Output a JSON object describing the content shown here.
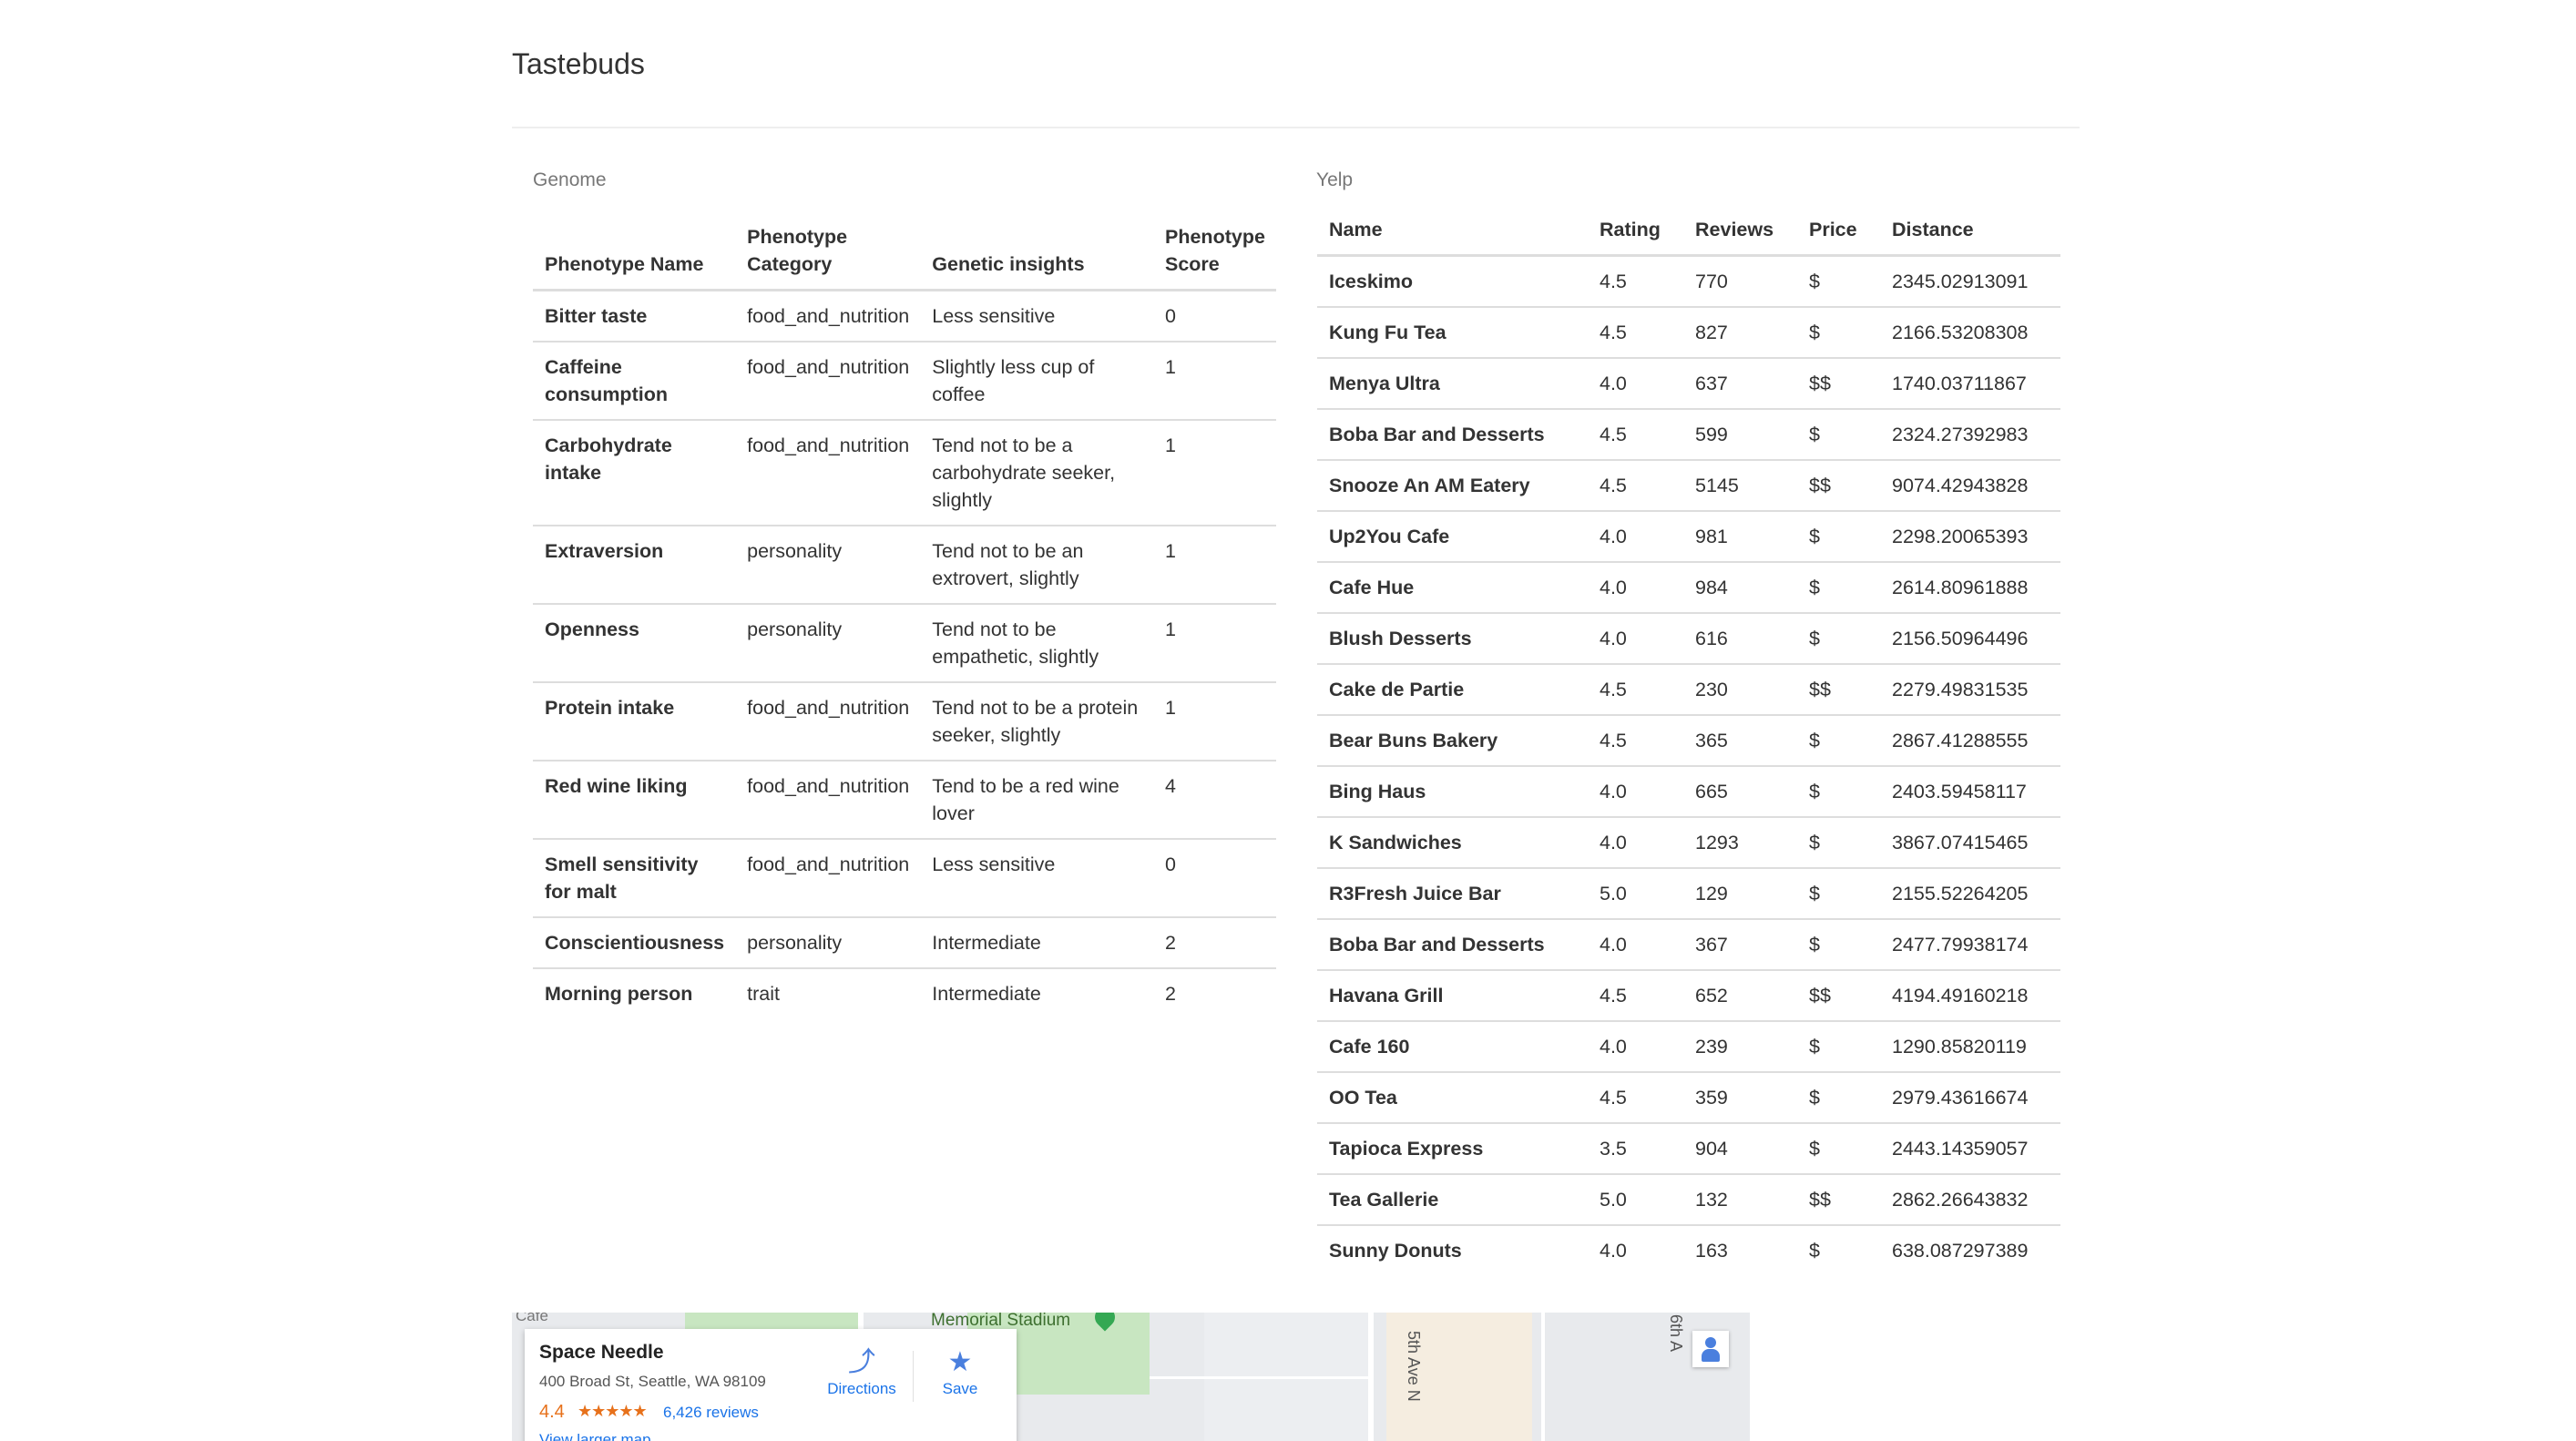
{
  "app": {
    "title": "Tastebuds"
  },
  "genome": {
    "heading": "Genome",
    "columns": [
      "Phenotype Name",
      "Phenotype Category",
      "Genetic insights",
      "Phenotype Score"
    ],
    "rows": [
      [
        "Bitter taste",
        "food_and_nutrition",
        "Less sensitive",
        "0"
      ],
      [
        "Caffeine consumption",
        "food_and_nutrition",
        "Slightly less cup of coffee",
        "1"
      ],
      [
        "Carbohydrate intake",
        "food_and_nutrition",
        "Tend not to be a carbohydrate seeker, slightly",
        "1"
      ],
      [
        "Extraversion",
        "personality",
        "Tend not to be an extrovert, slightly",
        "1"
      ],
      [
        "Openness",
        "personality",
        "Tend not to be empathetic, slightly",
        "1"
      ],
      [
        "Protein intake",
        "food_and_nutrition",
        "Tend not to be a protein seeker, slightly",
        "1"
      ],
      [
        "Red wine liking",
        "food_and_nutrition",
        "Tend to be a red wine lover",
        "4"
      ],
      [
        "Smell sensitivity for malt",
        "food_and_nutrition",
        "Less sensitive",
        "0"
      ],
      [
        "Conscientiousness",
        "personality",
        "Intermediate",
        "2"
      ],
      [
        "Morning person",
        "trait",
        "Intermediate",
        "2"
      ]
    ]
  },
  "yelp": {
    "heading": "Yelp",
    "columns": [
      "Name",
      "Rating",
      "Reviews",
      "Price",
      "Distance"
    ],
    "rows": [
      [
        "Iceskimo",
        "4.5",
        "770",
        "$",
        "2345.02913091"
      ],
      [
        "Kung Fu Tea",
        "4.5",
        "827",
        "$",
        "2166.53208308"
      ],
      [
        "Menya Ultra",
        "4.0",
        "637",
        "$$",
        "1740.03711867"
      ],
      [
        "Boba Bar and Desserts",
        "4.5",
        "599",
        "$",
        "2324.27392983"
      ],
      [
        "Snooze An AM Eatery",
        "4.5",
        "5145",
        "$$",
        "9074.42943828"
      ],
      [
        "Up2You Cafe",
        "4.0",
        "981",
        "$",
        "2298.20065393"
      ],
      [
        "Cafe Hue",
        "4.0",
        "984",
        "$",
        "2614.80961888"
      ],
      [
        "Blush Desserts",
        "4.0",
        "616",
        "$",
        "2156.50964496"
      ],
      [
        "Cake de Partie",
        "4.5",
        "230",
        "$$",
        "2279.49831535"
      ],
      [
        "Bear Buns Bakery",
        "4.5",
        "365",
        "$",
        "2867.41288555"
      ],
      [
        "Bing Haus",
        "4.0",
        "665",
        "$",
        "2403.59458117"
      ],
      [
        "K Sandwiches",
        "4.0",
        "1293",
        "$",
        "3867.07415465"
      ],
      [
        "R3Fresh Juice Bar",
        "5.0",
        "129",
        "$",
        "2155.52264205"
      ],
      [
        "Boba Bar and Desserts",
        "4.0",
        "367",
        "$",
        "2477.79938174"
      ],
      [
        "Havana Grill",
        "4.5",
        "652",
        "$$",
        "4194.49160218"
      ],
      [
        "Cafe 160",
        "4.0",
        "239",
        "$",
        "1290.85820119"
      ],
      [
        "OO Tea",
        "4.5",
        "359",
        "$",
        "2979.43616674"
      ],
      [
        "Tapioca Express",
        "3.5",
        "904",
        "$",
        "2443.14359057"
      ],
      [
        "Tea Gallerie",
        "5.0",
        "132",
        "$$",
        "2862.26643832"
      ],
      [
        "Sunny Donuts",
        "4.0",
        "163",
        "$",
        "638.087297389"
      ]
    ]
  },
  "map": {
    "cafe_label": "Cafe",
    "stadium_label": "Memorial Stadium",
    "street_label_1": "5th Ave N",
    "street_label_2": "6th A",
    "place_name": "Space Needle",
    "place_address": "400 Broad St, Seattle, WA 98109",
    "rating": "4.4",
    "stars": "★★★★★",
    "reviews": "6,426 reviews",
    "larger_map": "View larger map",
    "directions_label": "Directions",
    "save_label": "Save",
    "directions_icon": "directions-icon",
    "save_icon": "star-icon",
    "pegman_icon": "street-view-icon"
  }
}
